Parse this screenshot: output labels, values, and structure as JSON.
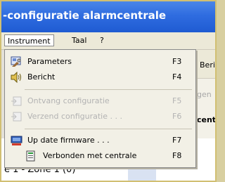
{
  "window": {
    "title": "-configuratie alarmcentrale"
  },
  "menubar": {
    "items": [
      {
        "label": "Instrument"
      },
      {
        "label": "Taal"
      },
      {
        "label": "?"
      }
    ]
  },
  "background": {
    "toolbar_fragment": "Beri",
    "tab_fragment": "gen",
    "panel_fragment": "cent",
    "tree_row": "e 1 - Zone 1 (0)"
  },
  "dropdown": {
    "items": [
      {
        "label": "Parameters",
        "shortcut": "F3",
        "enabled": true,
        "icon": "parameters-icon"
      },
      {
        "label": "Bericht",
        "shortcut": "F4",
        "enabled": true,
        "icon": "speaker-icon"
      },
      {
        "label": "Ontvang configuratie",
        "shortcut": "F5",
        "enabled": false,
        "icon": "receive-config-icon"
      },
      {
        "label": "Verzend configuratie . . .",
        "shortcut": "F6",
        "enabled": false,
        "icon": "send-config-icon"
      },
      {
        "label": "Up date firmware . . .",
        "shortcut": "F7",
        "enabled": true,
        "icon": "firmware-update-icon"
      },
      {
        "label": "Verbonden met centrale",
        "shortcut": "F8",
        "enabled": true,
        "icon": "connection-icon"
      }
    ]
  },
  "colors": {
    "titlebar": "#2f6ce0",
    "menu_bg": "#f2f0e6",
    "disabled_text": "#b3b3b3"
  }
}
